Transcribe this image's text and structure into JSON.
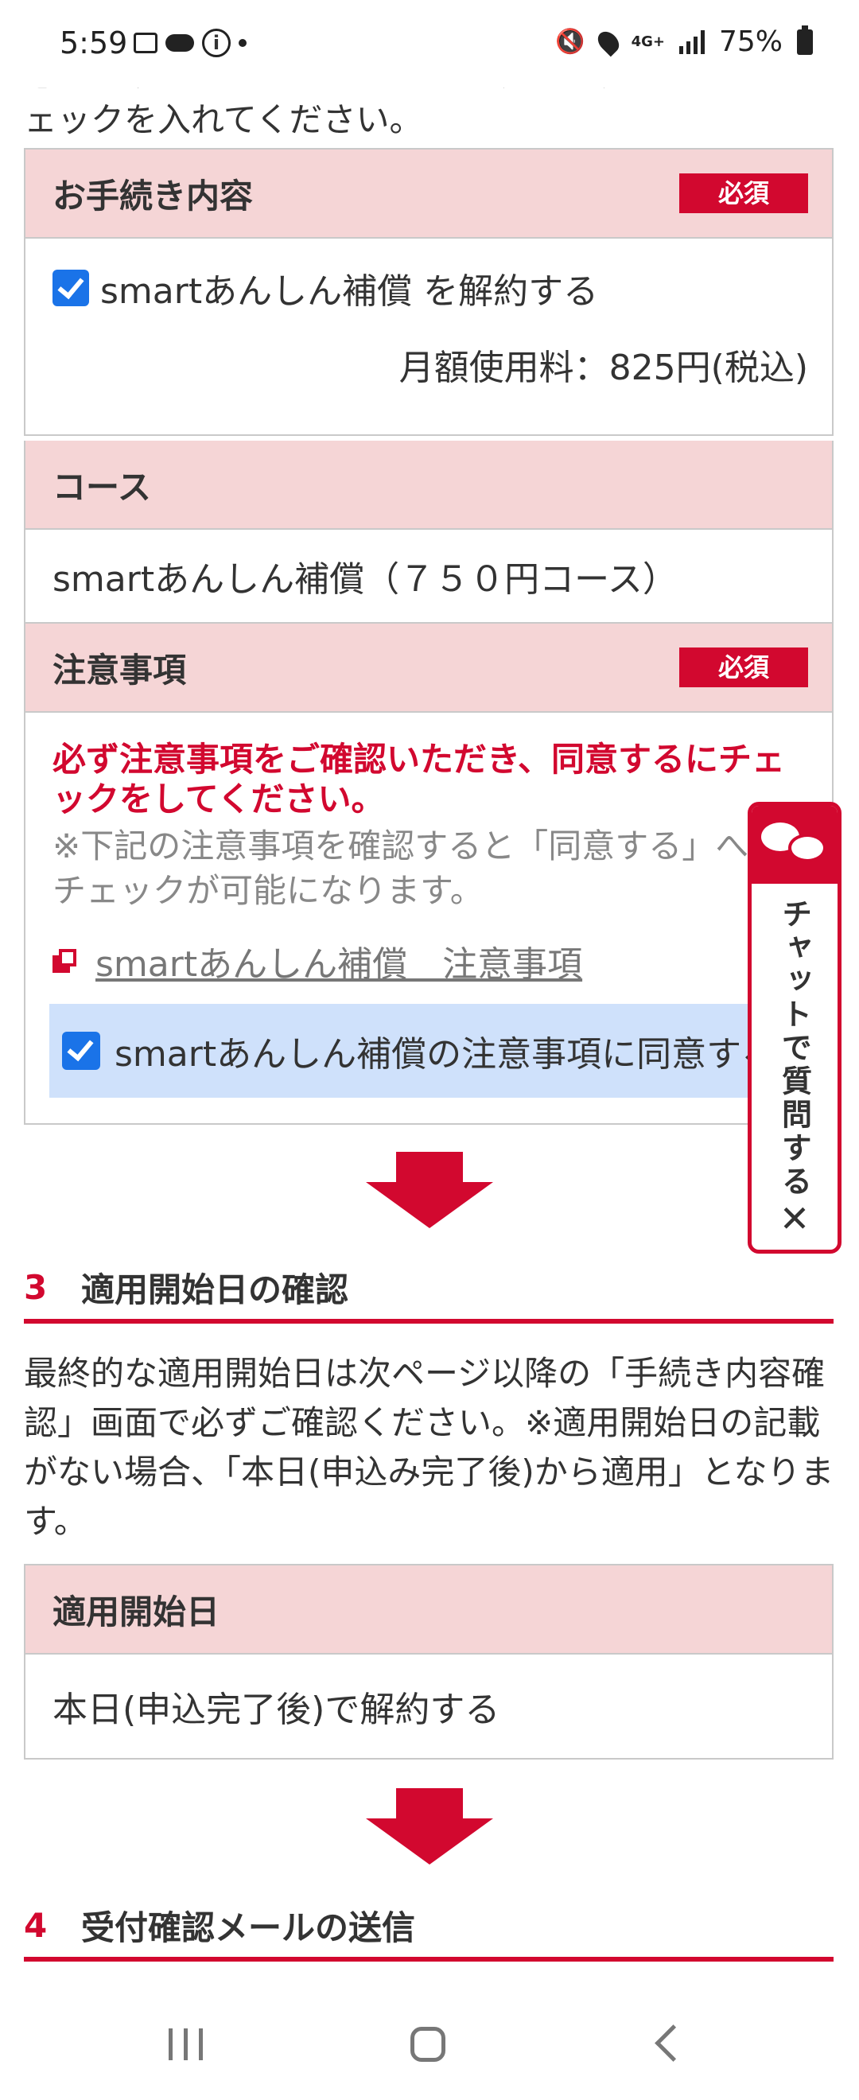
{
  "status_bar": {
    "time": "5:59",
    "network": "4G+",
    "battery": "75%"
  },
  "intro": {
    "line1": "必ずお読みになったうえ、チェックボックスにチ",
    "line2": "ェックを入れてください。"
  },
  "procedure": {
    "header": "お手続き内容",
    "badge": "必須",
    "checkbox_label": "smartあんしん補償 を解約する",
    "checked": true,
    "fee": "月額使用料：825円(税込)"
  },
  "course": {
    "header": "コース",
    "value": "smartあんしん補償（７５０円コース）"
  },
  "notes": {
    "header": "注意事項",
    "badge": "必須",
    "warning": "必ず注意事項をご確認いただき、同意するにチェックをしてください。",
    "hint": "※下記の注意事項を確認すると「同意する」へのチェックが可能になります。",
    "link": "smartあんしん補償　注意事項",
    "agree_label": "smartあんしん補償の注意事項に同意する",
    "agree_checked": true
  },
  "section3": {
    "number": "3",
    "title": "適用開始日の確認",
    "text": "最終的な適用開始日は次ページ以降の「手続き内容確認」画面で必ずご確認ください。※適用開始日の記載がない場合、「本日(申込み完了後)から適用」となります。"
  },
  "start_date": {
    "header": "適用開始日",
    "value": "本日(申込完了後)で解約する"
  },
  "section4": {
    "number": "4",
    "title": "受付確認メールの送信"
  },
  "chat_widget": {
    "label": "チャットで質問する",
    "close": "✕"
  }
}
